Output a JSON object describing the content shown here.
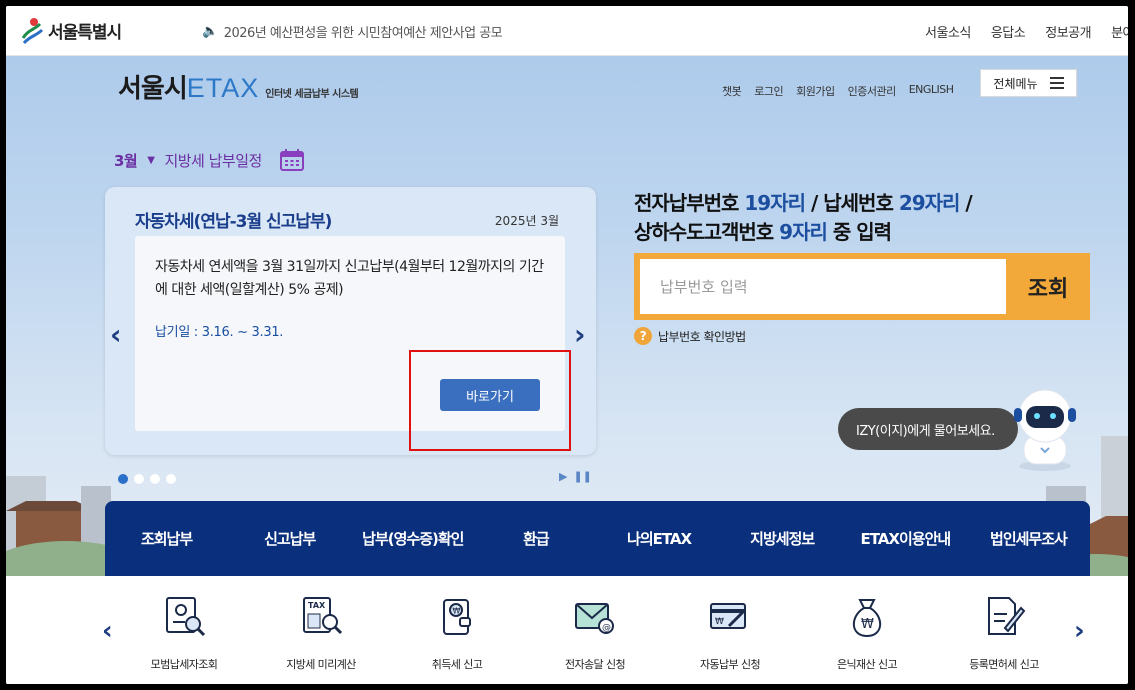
{
  "topbar": {
    "logo_text": "서울특별시",
    "notice": "2026년 예산편성을 위한 시민참여예산 제안사업 공모",
    "links": [
      "서울소식",
      "응답소",
      "정보공개",
      "분야"
    ]
  },
  "header": {
    "logo_main": "서울시",
    "logo_etax": "ETAX",
    "logo_sub": "인터넷 세금납부 시스템",
    "util_links": [
      "챗봇",
      "로그인",
      "회원가입",
      "인증서관리",
      "ENGLISH"
    ],
    "all_menu": "전체메뉴"
  },
  "schedule": {
    "month": "3월",
    "label": "지방세 납부일정"
  },
  "card": {
    "title": "자동차세(연납-3월 신고납부)",
    "date": "2025년 3월",
    "text": "자동차세 연세액을 3월 31일까지 신고납부(4월부터 12월까지의 기간에 대한 세액(일할계산) 5% 공제)",
    "due": "납기일 : 3.16. ~ 3.31.",
    "go_button": "바로가기"
  },
  "payment": {
    "title_parts": [
      "전자납부번호 ",
      "19자리",
      " / 납세번호 ",
      "29자리",
      " /",
      "상하수도고객번호 ",
      "9자리",
      " 중 입력"
    ],
    "placeholder": "납부번호 입력",
    "search_button": "조회",
    "help": "납부번호 확인방법"
  },
  "izy": {
    "bubble": "IZY(이지)에게 물어보세요."
  },
  "main_nav": [
    "조회납부",
    "신고납부",
    "납부(영수증)확인",
    "환급",
    "나의ETAX",
    "지방세정보",
    "ETAX이용안내",
    "법인세무조사"
  ],
  "quick_menu": [
    {
      "label": "모범납세자조회",
      "icon": "certificate-search-icon"
    },
    {
      "label": "지방세 미리계산",
      "icon": "tax-calculator-icon"
    },
    {
      "label": "취득세 신고",
      "icon": "wallet-won-icon"
    },
    {
      "label": "전자송달 신청",
      "icon": "email-icon"
    },
    {
      "label": "자동납부 신청",
      "icon": "card-auto-pay-icon"
    },
    {
      "label": "은닉재산 신고",
      "icon": "money-bag-icon"
    },
    {
      "label": "등록면허세 신고",
      "icon": "document-pen-icon"
    }
  ],
  "colors": {
    "nav_bg": "#0a2f7c",
    "accent_orange": "#f3a93a",
    "link_blue": "#2d79c8"
  }
}
